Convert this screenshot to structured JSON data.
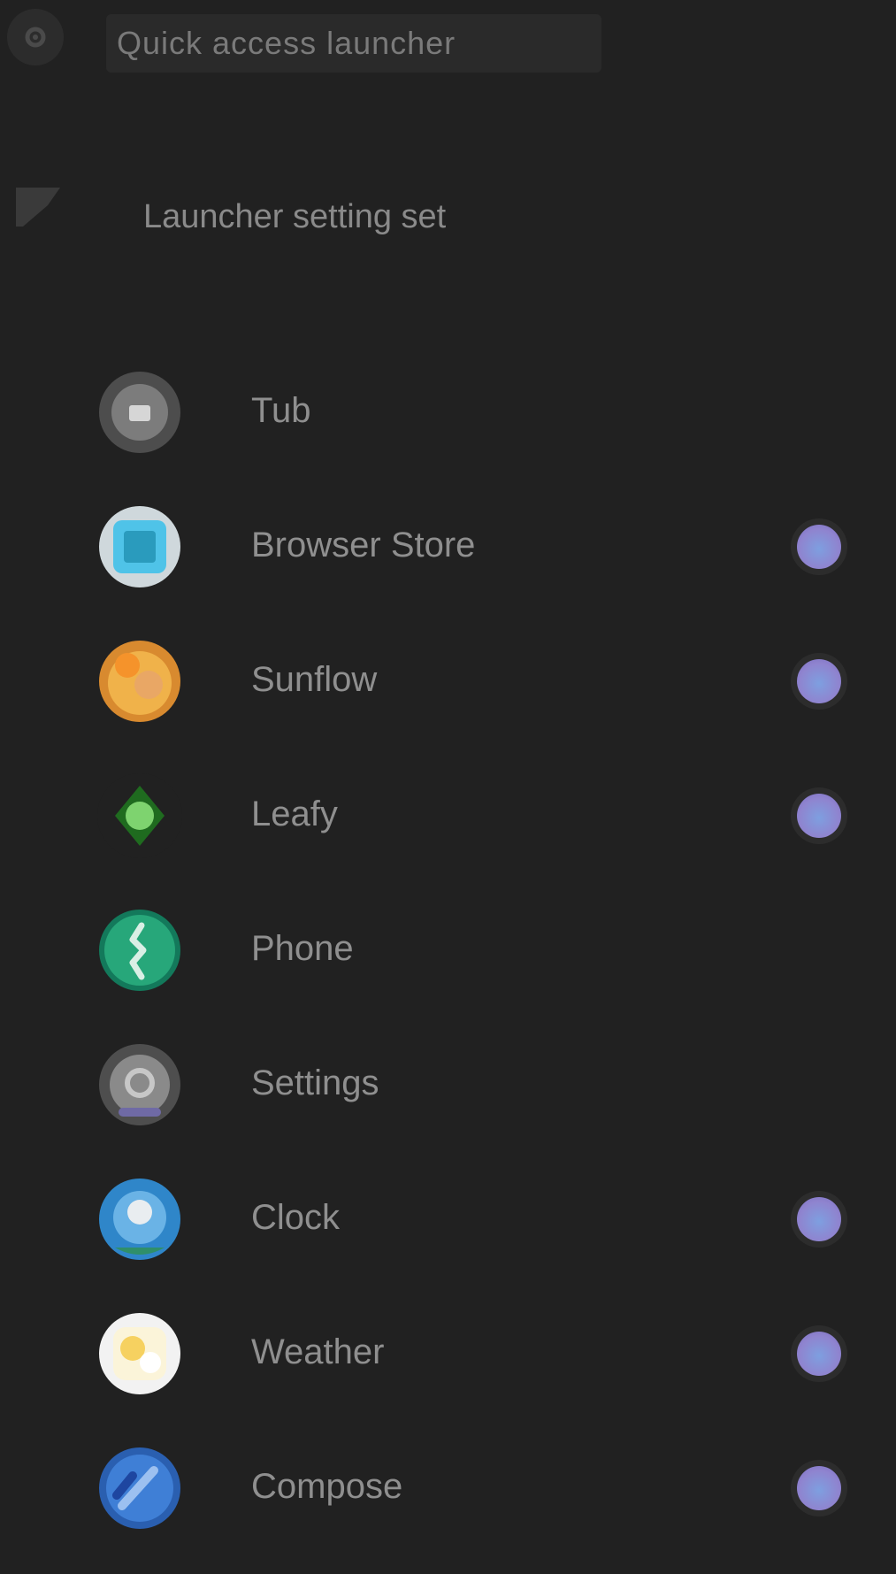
{
  "header": {
    "back_icon": "gear-icon",
    "title": "Quick access launcher"
  },
  "section": {
    "icon": "flag-icon",
    "title": "Launcher setting set"
  },
  "apps": [
    {
      "label": "Tub",
      "icon": "gray-app-icon",
      "badge": false
    },
    {
      "label": "Browser Store",
      "icon": "cyan-square-app-icon",
      "badge": true
    },
    {
      "label": "Sunflow",
      "icon": "orange-sun-app-icon",
      "badge": true
    },
    {
      "label": "Leafy",
      "icon": "green-leaf-app-icon",
      "badge": true
    },
    {
      "label": "Phone",
      "icon": "green-phone-app-icon",
      "badge": false
    },
    {
      "label": "Settings",
      "icon": "settings-gear-app-icon",
      "badge": false
    },
    {
      "label": "Clock",
      "icon": "blue-clock-app-icon",
      "badge": true
    },
    {
      "label": "Weather",
      "icon": "weather-app-icon",
      "badge": true
    },
    {
      "label": "Compose",
      "icon": "blue-pencil-app-icon",
      "badge": true
    }
  ],
  "colors": {
    "background": "#212121",
    "badge": "#8f84cf"
  }
}
